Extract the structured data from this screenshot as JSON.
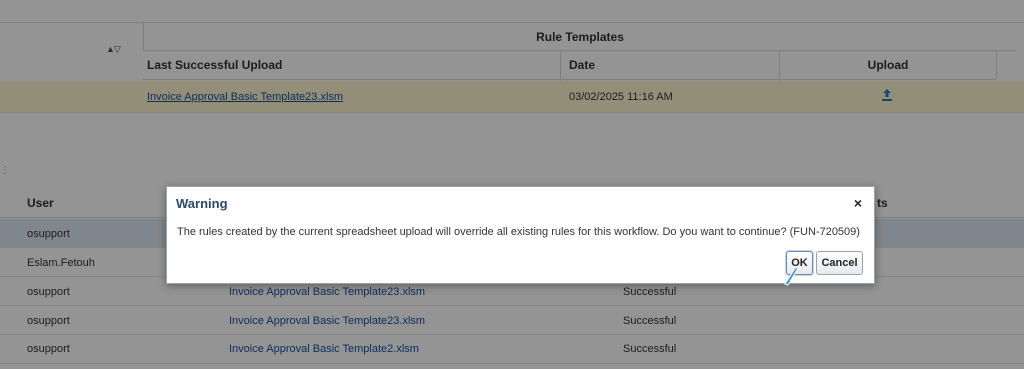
{
  "top_table": {
    "group_header": "Rule Templates",
    "columns": {
      "last_upload": "Last Successful Upload",
      "date": "Date",
      "upload": "Upload"
    },
    "row": {
      "file": "Invoice Approval Basic Template23.xlsm",
      "date": "03/02/2025 11:16 AM"
    }
  },
  "bottom_table": {
    "columns": {
      "user": "User",
      "comments_partial": "ts"
    },
    "rows": [
      {
        "user": "osupport",
        "file": "",
        "status": ""
      },
      {
        "user": "Eslam.Fetouh",
        "file": "",
        "status": ""
      },
      {
        "user": "osupport",
        "file": "Invoice Approval Basic Template23.xlsm",
        "status": "Successful"
      },
      {
        "user": "osupport",
        "file": "Invoice Approval Basic Template23.xlsm",
        "status": "Successful"
      },
      {
        "user": "osupport",
        "file": "Invoice Approval Basic Template2.xlsm",
        "status": "Successful"
      }
    ]
  },
  "dialog": {
    "title": "Warning",
    "close": "×",
    "message": "The rules created by the current spreadsheet upload will override all existing rules for this workflow. Do you want to continue? (FUN-720509)",
    "ok_label": "OK",
    "cancel_label": "Cancel"
  },
  "icons": {
    "sort": "sort-icon",
    "upload": "upload-icon",
    "close": "close-icon",
    "cursor": "pointer-cursor-icon"
  },
  "colors": {
    "link": "#1a4f9e",
    "title": "#29476b",
    "highlight_row": "#fdf5cf",
    "selected_row": "#dce7f3"
  }
}
